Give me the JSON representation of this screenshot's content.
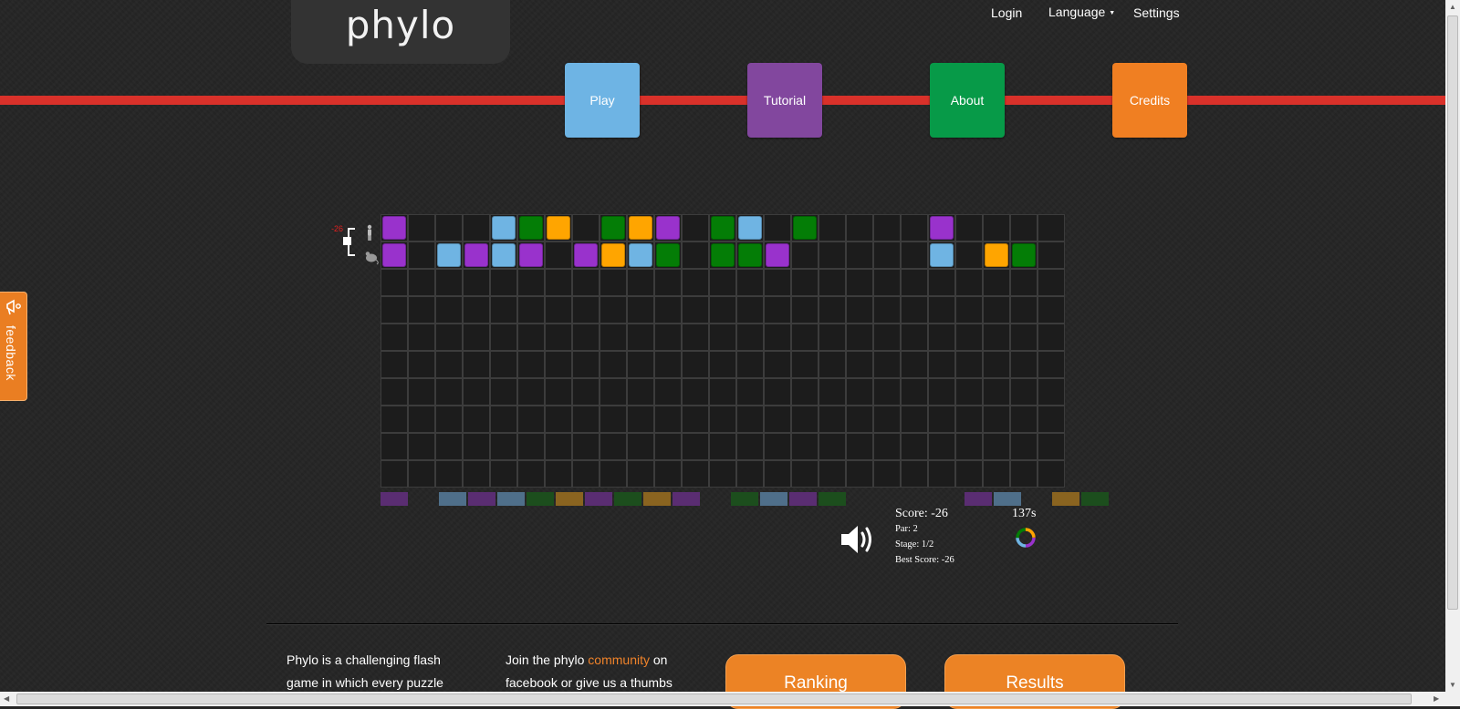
{
  "header": {
    "logo_text": "phylo",
    "nav_links": [
      "Login",
      "Language",
      "Settings"
    ]
  },
  "main_nav": [
    {
      "label": "Play",
      "color": "#6eb4e4"
    },
    {
      "label": "Tutorial",
      "color": "#82479e"
    },
    {
      "label": "About",
      "color": "#079a48"
    },
    {
      "label": "Credits",
      "color": "#f07f22"
    }
  ],
  "feedback_label": "feedback",
  "game": {
    "tree_score": "-26",
    "block_colors": {
      "P": "#9932cc",
      "B": "#6fb4e3",
      "G": "#047d06",
      "O": "#ffa500"
    },
    "bar_colors": {
      "P": "#5a2d72",
      "B": "#4f6f8a",
      "G": "#1c4e1d",
      "O": "#8a6420"
    },
    "columns": 25,
    "rows": 10,
    "sequences": [
      "P...BGO.GOP.GB.G....P....",
      "P.BPBP.POBG.GGP.....B.OG."
    ],
    "column_bar": "P.BPBGOPGOP.GBPG....PB.OG.",
    "score": {
      "score_text": "Score: -26",
      "par_text": "Par: 2",
      "stage_text": "Stage: 1/2",
      "best_text": "Best Score: -26",
      "timer_text": "137s"
    }
  },
  "footer": {
    "text1_lines": [
      "Phylo is a challenging flash",
      "game in which every puzzle"
    ],
    "text2_line1_pre": "Join the phylo ",
    "text2_link": "community",
    "text2_line1_post": " on",
    "text2_line2": "facebook or give us a thumbs",
    "ranking_label": "Ranking",
    "results_label": "Results"
  }
}
